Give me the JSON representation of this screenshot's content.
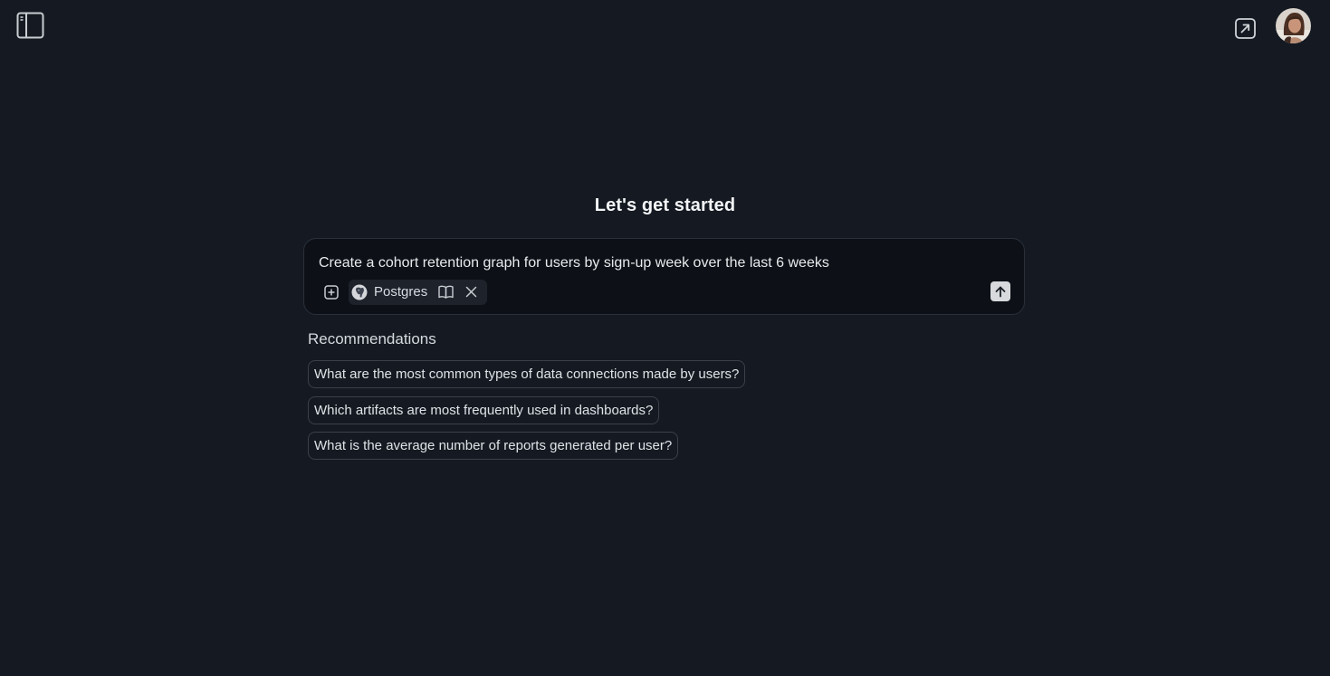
{
  "header": {
    "left_icon": "sidebar-toggle-icon",
    "right_icons": [
      "open-external-icon",
      "user-avatar"
    ]
  },
  "main": {
    "title": "Let's get started",
    "composer": {
      "input_value": "Create a cohort retention graph for users by sign-up week over the last 6 weeks",
      "source_label": "Postgres",
      "tool_icons": [
        "add-icon",
        "postgres-icon",
        "book-icon",
        "close-icon",
        "send-arrow-icon"
      ]
    },
    "recommendations": {
      "heading": "Recommendations",
      "items": [
        "What are the most common types of data connections made by users?",
        "Which artifacts are most frequently used in dashboards?",
        "What is the average number of reports generated per user?"
      ]
    }
  },
  "colors": {
    "background": "#151a22",
    "composer_bg": "#0d1117",
    "chip_border": "#3a404a",
    "send_button": "#d7d9dc"
  }
}
